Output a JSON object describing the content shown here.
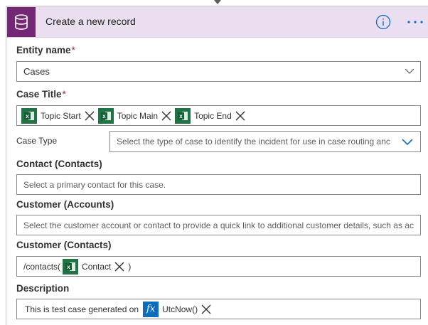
{
  "header": {
    "title": "Create a new record",
    "icon": "database-icon",
    "accent_color": "#742774"
  },
  "fields": {
    "entity_name": {
      "label": "Entity name",
      "required_mark": "*",
      "value": "Cases"
    },
    "case_title": {
      "label": "Case Title",
      "required_mark": "*",
      "tokens": [
        "Topic Start",
        "Topic Main",
        "Topic End"
      ]
    },
    "case_type": {
      "label": "Case Type",
      "placeholder": "Select the type of case to identify the incident for use in case routing anc"
    },
    "contact": {
      "label": "Contact (Contacts)",
      "placeholder": "Select a primary contact for this case."
    },
    "customer_accounts": {
      "label": "Customer (Accounts)",
      "placeholder": "Select the customer account or contact to provide a quick link to additional customer details, such as ac"
    },
    "customer_contacts": {
      "label": "Customer (Contacts)",
      "prefix": "/contacts(",
      "token": "Contact",
      "suffix": ")"
    },
    "description": {
      "label": "Description",
      "prefix": "This is test case generated on",
      "token_icon_text": "fx",
      "token": "UtcNow()"
    }
  }
}
